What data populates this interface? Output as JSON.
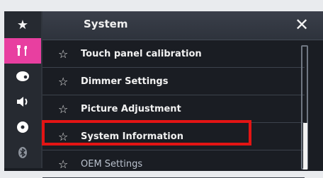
{
  "header": {
    "title": "System",
    "close_icon": "close-icon"
  },
  "sidebar": {
    "items": [
      {
        "icon": "star-icon"
      },
      {
        "icon": "tools-icon",
        "active": true
      },
      {
        "icon": "palette-icon"
      },
      {
        "icon": "speaker-icon"
      },
      {
        "icon": "disc-icon"
      },
      {
        "icon": "bluetooth-icon"
      }
    ],
    "active_color": "#e83fa0"
  },
  "menu": {
    "items": [
      {
        "label": "Touch panel calibration"
      },
      {
        "label": "Dimmer Settings"
      },
      {
        "label": "Picture Adjustment"
      },
      {
        "label": "System Information"
      },
      {
        "label": "OEM Settings"
      }
    ],
    "star_icon": "star-outline-icon"
  },
  "highlight_color": "#e31414"
}
